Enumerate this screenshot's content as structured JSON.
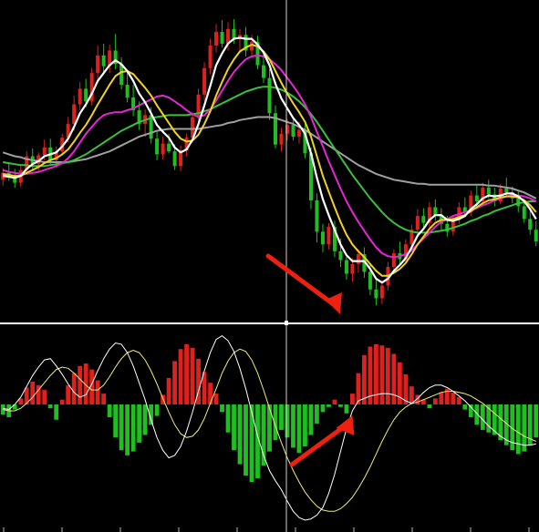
{
  "colors": {
    "background": "#000000",
    "bull": "#e0201c",
    "bear": "#1fbf22",
    "ma_fast": "#ffffff",
    "ma_mid": "#f2d21e",
    "ma_slow": "#e526d6",
    "ma_long": "#3cbf3c",
    "ma_very_long": "#a0a0a0",
    "separator": "#ffffff",
    "crosshair": "#d0d0d0",
    "arrow": "#ee2010",
    "macd_line": "#ffffff",
    "signal_line": "#f0ec7a"
  },
  "chart_data": [
    {
      "type": "candlestick",
      "panel": "price",
      "candles": [
        [
          9.2,
          10.4,
          8.6,
          9.9
        ],
        [
          9.9,
          11.0,
          9.1,
          9.5
        ],
        [
          9.5,
          10.3,
          8.4,
          8.9
        ],
        [
          8.9,
          10.6,
          8.5,
          10.2
        ],
        [
          10.2,
          12.1,
          9.9,
          11.6
        ],
        [
          11.6,
          12.4,
          10.3,
          10.8
        ],
        [
          10.8,
          12.0,
          10.1,
          11.7
        ],
        [
          11.7,
          13.3,
          11.2,
          12.5
        ],
        [
          12.5,
          13.4,
          10.8,
          11.2
        ],
        [
          11.2,
          12.6,
          10.4,
          12.1
        ],
        [
          12.1,
          13.9,
          11.7,
          13.5
        ],
        [
          13.5,
          15.6,
          13.0,
          14.9
        ],
        [
          14.9,
          17.8,
          14.2,
          16.9
        ],
        [
          16.9,
          19.2,
          16.3,
          18.5
        ],
        [
          18.5,
          19.5,
          16.6,
          17.2
        ],
        [
          17.2,
          20.6,
          16.8,
          20.1
        ],
        [
          20.1,
          22.9,
          19.4,
          21.9
        ],
        [
          21.9,
          23.1,
          20.2,
          20.8
        ],
        [
          20.8,
          23.0,
          20.1,
          22.4
        ],
        [
          22.4,
          24.1,
          20.5,
          21.0
        ],
        [
          21.0,
          21.7,
          18.4,
          18.9
        ],
        [
          18.9,
          20.2,
          17.1,
          17.6
        ],
        [
          17.6,
          18.9,
          15.7,
          16.3
        ],
        [
          16.3,
          17.2,
          14.3,
          14.9
        ],
        [
          14.9,
          16.4,
          13.6,
          15.8
        ],
        [
          15.8,
          16.6,
          12.9,
          13.4
        ],
        [
          13.4,
          14.1,
          11.2,
          11.8
        ],
        [
          11.8,
          13.6,
          11.3,
          12.9
        ],
        [
          12.9,
          13.9,
          11.9,
          12.1
        ],
        [
          12.1,
          12.8,
          10.2,
          10.6
        ],
        [
          10.6,
          12.7,
          10.1,
          12.2
        ],
        [
          12.2,
          13.9,
          11.6,
          13.5
        ],
        [
          13.5,
          16.1,
          13.0,
          15.6
        ],
        [
          15.6,
          18.5,
          15.0,
          17.9
        ],
        [
          17.9,
          21.2,
          17.3,
          20.6
        ],
        [
          20.6,
          23.6,
          20.0,
          22.9
        ],
        [
          22.9,
          25.1,
          22.2,
          24.3
        ],
        [
          24.3,
          25.5,
          22.7,
          23.1
        ],
        [
          23.1,
          25.3,
          22.4,
          24.6
        ],
        [
          24.6,
          25.6,
          23.1,
          23.6
        ],
        [
          23.6,
          24.6,
          22.3,
          24.0
        ],
        [
          24.0,
          24.8,
          21.8,
          22.4
        ],
        [
          22.4,
          24.0,
          21.9,
          23.3
        ],
        [
          23.3,
          23.9,
          20.5,
          20.9
        ],
        [
          20.9,
          22.0,
          19.1,
          19.6
        ],
        [
          19.6,
          20.5,
          15.3,
          16.0
        ],
        [
          16.0,
          16.8,
          12.4,
          12.8
        ],
        [
          12.8,
          14.5,
          12.1,
          13.9
        ],
        [
          13.9,
          15.4,
          13.2,
          14.8
        ],
        [
          14.8,
          15.5,
          13.2,
          13.6
        ],
        [
          13.6,
          15.1,
          12.9,
          14.3
        ],
        [
          14.3,
          14.9,
          11.4,
          11.9
        ],
        [
          11.9,
          12.5,
          6.2,
          7.1
        ],
        [
          7.1,
          7.8,
          2.8,
          3.9
        ],
        [
          3.9,
          4.7,
          1.8,
          2.6
        ],
        [
          2.6,
          4.8,
          2.1,
          4.4
        ],
        [
          4.4,
          5.0,
          1.3,
          1.9
        ],
        [
          1.9,
          3.2,
          0.3,
          1.0
        ],
        [
          1.0,
          1.7,
          -1.0,
          -0.4
        ],
        [
          -0.4,
          1.2,
          -1.2,
          0.6
        ],
        [
          0.6,
          2.1,
          -0.3,
          1.6
        ],
        [
          1.6,
          2.3,
          -0.8,
          -0.2
        ],
        [
          -0.2,
          0.6,
          -2.6,
          -2.0
        ],
        [
          -2.0,
          -0.9,
          -3.6,
          -2.9
        ],
        [
          -2.9,
          -1.1,
          -3.5,
          -1.6
        ],
        [
          -1.6,
          0.8,
          -2.1,
          0.3
        ],
        [
          0.3,
          2.1,
          -0.2,
          1.7
        ],
        [
          1.7,
          2.9,
          0.6,
          1.1
        ],
        [
          1.1,
          3.1,
          0.7,
          2.6
        ],
        [
          2.6,
          4.6,
          2.2,
          4.1
        ],
        [
          4.1,
          6.2,
          3.5,
          5.5
        ],
        [
          5.5,
          6.3,
          4.3,
          4.8
        ],
        [
          4.8,
          6.9,
          4.4,
          6.4
        ],
        [
          6.4,
          7.2,
          5.0,
          5.6
        ],
        [
          5.6,
          6.3,
          4.1,
          4.7
        ],
        [
          4.7,
          5.5,
          3.4,
          3.9
        ],
        [
          3.9,
          5.6,
          3.5,
          5.1
        ],
        [
          5.1,
          6.9,
          4.7,
          6.4
        ],
        [
          6.4,
          7.4,
          5.4,
          5.9
        ],
        [
          5.9,
          8.1,
          5.5,
          7.6
        ],
        [
          7.6,
          8.6,
          6.5,
          7.0
        ],
        [
          7.0,
          8.9,
          6.6,
          8.4
        ],
        [
          8.4,
          9.2,
          7.3,
          7.7
        ],
        [
          7.7,
          8.4,
          6.5,
          7.0
        ],
        [
          7.0,
          8.8,
          6.7,
          8.3
        ],
        [
          8.3,
          9.4,
          7.5,
          7.9
        ],
        [
          7.9,
          8.5,
          6.8,
          7.3
        ],
        [
          7.3,
          8.1,
          5.9,
          6.5
        ],
        [
          6.5,
          7.1,
          4.8,
          5.2
        ],
        [
          5.2,
          6.1,
          3.6,
          4.1
        ],
        [
          4.1,
          5.0,
          2.4,
          2.9
        ]
      ],
      "moving_averages": {
        "fast": [
          9.6,
          9.5,
          9.4,
          9.6,
          10.3,
          10.8,
          11.1,
          11.6,
          11.8,
          12.0,
          12.6,
          13.4,
          14.6,
          16.0,
          16.9,
          18.0,
          19.3,
          20.1,
          20.9,
          21.4,
          21.0,
          20.3,
          19.3,
          18.0,
          17.1,
          16.0,
          14.8,
          14.1,
          13.5,
          12.5,
          12.0,
          12.3,
          13.3,
          14.9,
          16.8,
          18.8,
          20.9,
          22.1,
          23.1,
          23.6,
          23.7,
          23.6,
          23.6,
          23.0,
          22.2,
          20.9,
          19.0,
          17.5,
          16.5,
          15.5,
          14.8,
          13.9,
          11.9,
          9.4,
          7.2,
          5.6,
          4.1,
          2.6,
          1.5,
          0.9,
          0.9,
          0.9,
          0.1,
          -0.9,
          -1.3,
          -0.9,
          -0.1,
          0.5,
          1.2,
          2.3,
          3.5,
          4.2,
          5.1,
          5.6,
          5.6,
          5.1,
          5.0,
          5.2,
          5.5,
          6.2,
          6.7,
          7.3,
          7.6,
          7.5,
          7.6,
          7.8,
          7.8,
          7.5,
          7.0,
          6.2,
          5.2
        ],
        "mid": [
          9.8,
          9.7,
          9.6,
          9.6,
          9.9,
          10.2,
          10.5,
          10.9,
          11.2,
          11.4,
          11.8,
          12.3,
          13.1,
          14.0,
          14.8,
          15.8,
          16.9,
          17.9,
          18.9,
          19.8,
          20.2,
          20.3,
          20.0,
          19.3,
          18.6,
          17.8,
          16.8,
          15.9,
          15.0,
          14.1,
          13.4,
          13.1,
          13.2,
          13.8,
          14.9,
          16.2,
          17.8,
          19.2,
          20.5,
          21.5,
          22.3,
          22.7,
          23.0,
          22.8,
          22.3,
          21.5,
          20.3,
          19.1,
          18.0,
          17.0,
          16.1,
          15.1,
          13.6,
          11.6,
          9.6,
          8.0,
          6.4,
          4.9,
          3.6,
          2.6,
          1.9,
          1.3,
          0.6,
          -0.1,
          -0.6,
          -0.6,
          -0.3,
          0.1,
          0.7,
          1.6,
          2.6,
          3.4,
          4.2,
          4.8,
          5.1,
          5.1,
          5.2,
          5.4,
          5.6,
          6.0,
          6.4,
          6.8,
          7.1,
          7.2,
          7.4,
          7.5,
          7.5,
          7.4,
          7.1,
          6.6,
          5.9
        ],
        "slow": [
          10.2,
          10.0,
          9.9,
          9.8,
          9.8,
          9.9,
          10.0,
          10.2,
          10.4,
          10.6,
          10.9,
          11.4,
          12.1,
          13.0,
          13.9,
          14.6,
          15.3,
          15.8,
          16.0,
          16.1,
          16.1,
          16.3,
          16.5,
          16.8,
          17.1,
          17.4,
          17.7,
          17.8,
          17.6,
          17.2,
          16.8,
          16.3,
          15.9,
          15.6,
          15.8,
          16.4,
          17.3,
          18.3,
          19.3,
          20.2,
          20.9,
          21.5,
          21.8,
          21.9,
          21.8,
          21.5,
          21.0,
          20.4,
          19.6,
          18.8,
          17.9,
          16.9,
          15.6,
          14.1,
          12.6,
          11.1,
          9.7,
          8.3,
          7.0,
          5.9,
          4.9,
          4.0,
          3.1,
          2.3,
          1.7,
          1.4,
          1.3,
          1.4,
          1.6,
          2.0,
          2.6,
          3.2,
          3.8,
          4.4,
          4.9,
          5.2,
          5.5,
          5.7,
          5.9,
          6.1,
          6.3,
          6.6,
          6.8,
          7.1,
          7.3,
          7.5,
          7.6,
          7.6,
          7.5,
          7.3,
          7.0
        ],
        "long": [
          11.0,
          10.9,
          10.8,
          10.7,
          10.7,
          10.6,
          10.6,
          10.6,
          10.7,
          10.8,
          10.9,
          11.0,
          11.2,
          11.5,
          11.8,
          12.2,
          12.6,
          13.0,
          13.4,
          13.8,
          14.2,
          14.5,
          14.8,
          15.1,
          15.3,
          15.5,
          15.6,
          15.7,
          15.8,
          15.8,
          15.8,
          15.8,
          15.9,
          16.0,
          16.2,
          16.4,
          16.7,
          17.0,
          17.3,
          17.6,
          17.9,
          18.2,
          18.4,
          18.6,
          18.7,
          18.7,
          18.6,
          18.4,
          18.1,
          17.7,
          17.2,
          16.6,
          15.9,
          15.1,
          14.2,
          13.3,
          12.4,
          11.5,
          10.6,
          9.7,
          8.9,
          8.1,
          7.3,
          6.6,
          5.9,
          5.3,
          4.8,
          4.4,
          4.1,
          3.9,
          3.8,
          3.8,
          3.8,
          3.9,
          4.0,
          4.1,
          4.3,
          4.5,
          4.7,
          5.0,
          5.2,
          5.5,
          5.7,
          6.0,
          6.2,
          6.4,
          6.6,
          6.8,
          6.9,
          7.0,
          7.0
        ],
        "very_long": [
          12.0,
          11.8,
          11.6,
          11.5,
          11.3,
          11.2,
          11.1,
          11.0,
          11.0,
          11.0,
          11.0,
          11.0,
          11.1,
          11.2,
          11.3,
          11.5,
          11.7,
          11.9,
          12.1,
          12.4,
          12.7,
          13.0,
          13.3,
          13.6,
          13.8,
          14.0,
          14.2,
          14.3,
          14.4,
          14.4,
          14.4,
          14.4,
          14.4,
          14.4,
          14.5,
          14.6,
          14.7,
          14.8,
          15.0,
          15.1,
          15.3,
          15.4,
          15.5,
          15.6,
          15.6,
          15.6,
          15.5,
          15.3,
          15.1,
          14.9,
          14.6,
          14.3,
          13.9,
          13.5,
          13.1,
          12.7,
          12.3,
          11.9,
          11.5,
          11.1,
          10.7,
          10.4,
          10.1,
          9.8,
          9.6,
          9.4,
          9.2,
          9.1,
          9.0,
          8.9,
          8.8,
          8.8,
          8.7,
          8.7,
          8.7,
          8.7,
          8.7,
          8.7,
          8.7,
          8.7,
          8.7,
          8.7,
          8.6,
          8.6,
          8.5,
          8.4,
          8.3,
          8.1,
          7.9,
          7.6,
          7.3
        ]
      },
      "ylim": [
        -5,
        27
      ],
      "annotations": [
        {
          "type": "arrow",
          "at_index": 60,
          "points": "down"
        }
      ]
    },
    {
      "type": "macd",
      "panel": "indicator",
      "histogram": [
        -0.8,
        -1.0,
        -0.4,
        0.5,
        1.4,
        1.9,
        1.6,
        1.2,
        -0.3,
        -1.2,
        0.4,
        1.6,
        2.6,
        3.2,
        3.4,
        2.9,
        2.0,
        0.9,
        -1.0,
        -2.6,
        -3.6,
        -4.0,
        -3.7,
        -3.0,
        -2.4,
        -1.6,
        -0.9,
        0.8,
        2.2,
        3.6,
        4.6,
        5.0,
        4.7,
        3.8,
        2.7,
        1.8,
        0.9,
        -0.6,
        -2.2,
        -3.6,
        -4.7,
        -5.6,
        -6.1,
        -5.8,
        -4.8,
        -3.7,
        -2.8,
        -2.0,
        -2.6,
        -3.4,
        -3.8,
        -3.3,
        -2.4,
        -1.5,
        -0.6,
        -0.2,
        0.4,
        -0.2,
        -0.7,
        0.9,
        2.6,
        4.1,
        4.8,
        5.0,
        4.9,
        4.7,
        4.2,
        3.5,
        2.5,
        1.5,
        0.8,
        0.4,
        -0.3,
        0.5,
        1.0,
        1.3,
        1.0,
        0.6,
        -0.4,
        -1.0,
        -1.6,
        -2.0,
        -2.2,
        -2.4,
        -2.8,
        -3.2,
        -3.6,
        -3.9,
        -3.7,
        -3.2,
        -2.6
      ],
      "macd": [
        -0.3,
        -0.4,
        0.0,
        0.6,
        1.5,
        2.4,
        3.1,
        3.7,
        3.8,
        3.2,
        2.5,
        1.7,
        1.0,
        0.6,
        0.8,
        1.7,
        2.8,
        3.8,
        4.6,
        5.1,
        5.0,
        4.3,
        3.2,
        1.8,
        0.4,
        -1.2,
        -2.6,
        -3.6,
        -4.2,
        -4.0,
        -3.3,
        -2.1,
        -0.6,
        1.1,
        2.8,
        4.3,
        5.4,
        5.7,
        5.3,
        4.4,
        3.0,
        1.3,
        -0.6,
        -2.5,
        -4.0,
        -5.2,
        -6.0,
        -6.7,
        -7.6,
        -8.4,
        -8.9,
        -9.1,
        -9.0,
        -8.7,
        -8.1,
        -7.0,
        -5.5,
        -3.7,
        -1.9,
        -0.5,
        0.3,
        0.5,
        0.7,
        0.8,
        0.9,
        0.9,
        0.8,
        0.6,
        0.3,
        0.1,
        0.5,
        1.0,
        1.4,
        1.6,
        1.6,
        1.4,
        1.1,
        0.7,
        0.3,
        -0.2,
        -0.7,
        -1.2,
        -1.7,
        -2.1,
        -2.5,
        -2.8,
        -3.0,
        -3.1,
        -3.2,
        -3.2,
        -3.1
      ],
      "signal": [
        -0.4,
        -0.5,
        -0.5,
        -0.3,
        0.1,
        0.6,
        1.2,
        1.8,
        2.4,
        2.9,
        3.1,
        3.0,
        2.6,
        2.1,
        1.6,
        1.2,
        1.2,
        1.6,
        2.3,
        3.1,
        3.8,
        4.3,
        4.5,
        4.3,
        3.7,
        2.8,
        1.7,
        0.5,
        -0.6,
        -1.6,
        -2.3,
        -2.6,
        -2.5,
        -2.0,
        -1.1,
        0.1,
        1.3,
        2.6,
        3.6,
        4.3,
        4.6,
        4.4,
        3.7,
        2.6,
        1.2,
        -0.3,
        -1.7,
        -3.0,
        -4.2,
        -5.2,
        -6.1,
        -6.9,
        -7.5,
        -8.0,
        -8.3,
        -8.4,
        -8.4,
        -8.2,
        -7.8,
        -7.3,
        -6.6,
        -5.8,
        -4.9,
        -3.9,
        -2.9,
        -2.0,
        -1.2,
        -0.6,
        -0.2,
        0.1,
        0.2,
        0.4,
        0.6,
        0.8,
        1.0,
        1.1,
        1.1,
        1.0,
        0.9,
        0.7,
        0.4,
        0.1,
        -0.3,
        -0.7,
        -1.1,
        -1.5,
        -1.9,
        -2.2,
        -2.5,
        -2.7,
        -2.9
      ],
      "ylim": [
        -9.6,
        6.2
      ],
      "annotations": [
        {
          "type": "arrow",
          "at_index": 57,
          "points": "up"
        }
      ]
    }
  ]
}
